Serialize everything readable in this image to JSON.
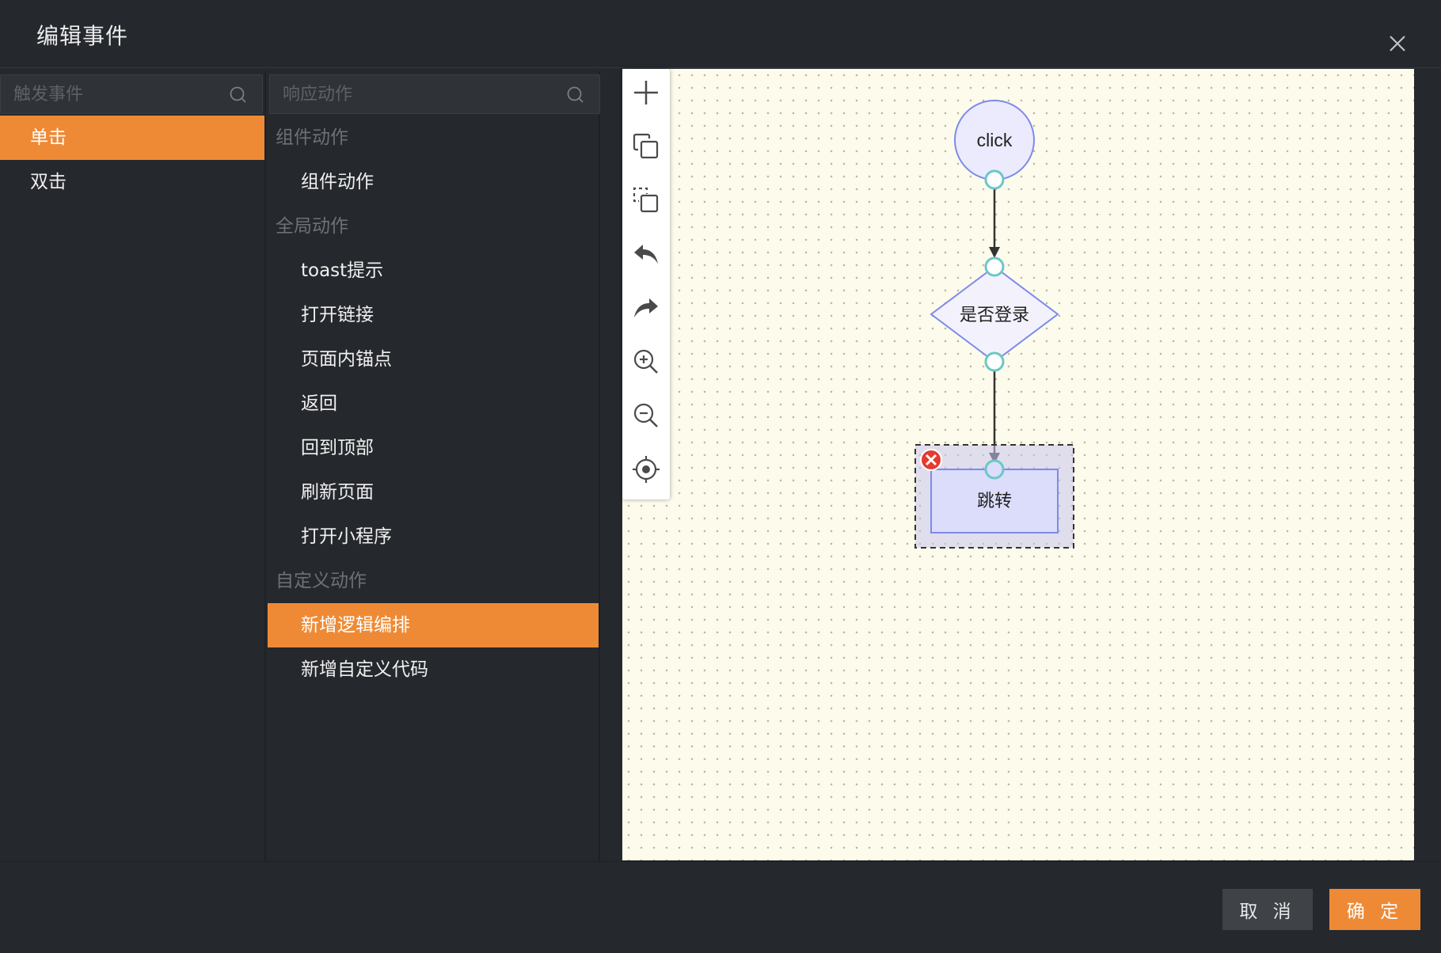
{
  "dialog": {
    "title": "编辑事件"
  },
  "left_panel": {
    "search_placeholder": "触发事件",
    "items": [
      {
        "label": "单击",
        "active": true
      },
      {
        "label": "双击",
        "active": false
      }
    ]
  },
  "mid_panel": {
    "search_placeholder": "响应动作",
    "groups": [
      {
        "title": "组件动作",
        "items": [
          "组件动作"
        ]
      },
      {
        "title": "全局动作",
        "items": [
          "toast提示",
          "打开链接",
          "页面内锚点",
          "返回",
          "回到顶部",
          "刷新页面",
          "打开小程序"
        ]
      },
      {
        "title": "自定义动作",
        "items": [
          "新增逻辑编排",
          "新增自定义代码"
        ]
      }
    ],
    "active_item": "新增逻辑编排"
  },
  "toolbar": {
    "tools": [
      "add-icon",
      "copy-icon",
      "paste-icon",
      "undo-icon",
      "redo-icon",
      "zoom-in-icon",
      "zoom-out-icon",
      "locate-icon"
    ]
  },
  "flow": {
    "start_node": "click",
    "condition_node": "是否登录",
    "action_node": "跳转"
  },
  "footer": {
    "cancel_label": "取 消",
    "ok_label": "确 定"
  },
  "colors": {
    "accent": "#ee8a35",
    "background": "#25282d",
    "canvas": "#fdfbec",
    "port": "#6cc7c6",
    "node_fill": "#e9e8fd",
    "node_stroke": "#7c8be9"
  }
}
